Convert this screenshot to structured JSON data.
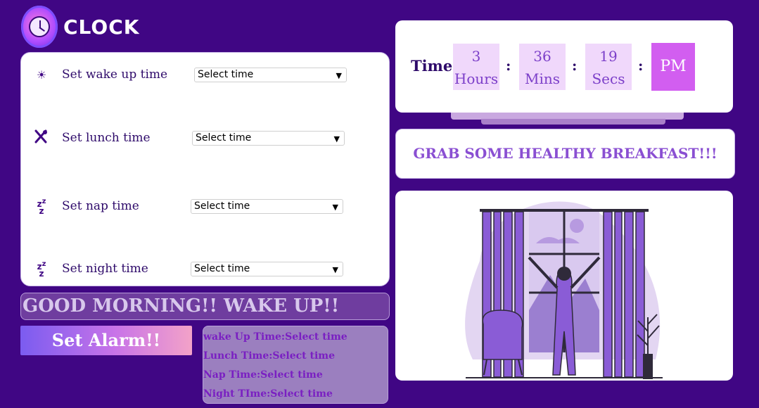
{
  "app": {
    "title": "CLOCK",
    "logo_icon": "clock-icon"
  },
  "settings": {
    "rows": [
      {
        "icon": "sun-icon",
        "label": "Set wake up time",
        "select_value": "Select time"
      },
      {
        "icon": "utensils-icon",
        "label": "Set lunch time",
        "select_value": "Select time"
      },
      {
        "icon": "sleep-zzz-icon",
        "label": "Set nap time",
        "select_value": "Select time"
      },
      {
        "icon": "sleep-zzz-icon",
        "label": "Set night time",
        "select_value": "Select time"
      }
    ]
  },
  "greeting": "GOOD MORNING!! WAKE UP!!",
  "alarm_button": "Set Alarm!!",
  "summary": [
    "wake Up Time:Select time",
    "Lunch Time:Select time",
    "Nap Time:Select time",
    "Night TIme:Select time"
  ],
  "clock": {
    "label": "Time",
    "hours": "3",
    "hours_unit": "Hours",
    "mins": "36",
    "mins_unit": "Mins",
    "secs": "19",
    "secs_unit": "Secs",
    "separator": ":",
    "ampm": "PM"
  },
  "message": "GRAB SOME HEALTHY BREAKFAST!!!",
  "colors": {
    "background": "#400684",
    "accent": "#d25ef0",
    "message": "#8a4fd2"
  }
}
